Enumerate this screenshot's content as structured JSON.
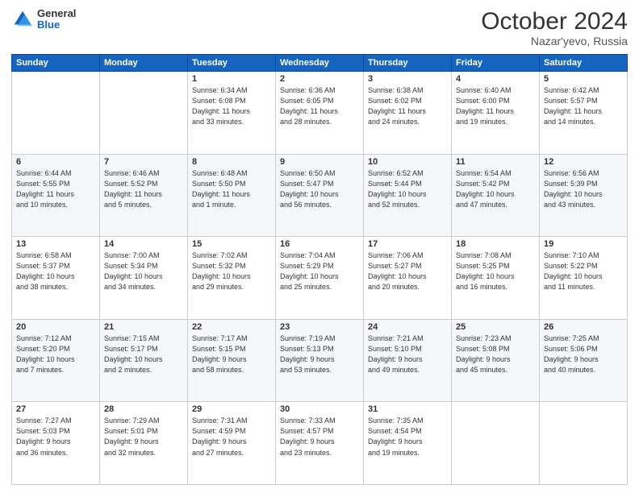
{
  "logo": {
    "general": "General",
    "blue": "Blue"
  },
  "header": {
    "month": "October 2024",
    "location": "Nazar'yevo, Russia"
  },
  "weekdays": [
    "Sunday",
    "Monday",
    "Tuesday",
    "Wednesday",
    "Thursday",
    "Friday",
    "Saturday"
  ],
  "weeks": [
    [
      {
        "day": "",
        "info": ""
      },
      {
        "day": "",
        "info": ""
      },
      {
        "day": "1",
        "info": "Sunrise: 6:34 AM\nSunset: 6:08 PM\nDaylight: 11 hours\nand 33 minutes."
      },
      {
        "day": "2",
        "info": "Sunrise: 6:36 AM\nSunset: 6:05 PM\nDaylight: 11 hours\nand 28 minutes."
      },
      {
        "day": "3",
        "info": "Sunrise: 6:38 AM\nSunset: 6:02 PM\nDaylight: 11 hours\nand 24 minutes."
      },
      {
        "day": "4",
        "info": "Sunrise: 6:40 AM\nSunset: 6:00 PM\nDaylight: 11 hours\nand 19 minutes."
      },
      {
        "day": "5",
        "info": "Sunrise: 6:42 AM\nSunset: 5:57 PM\nDaylight: 11 hours\nand 14 minutes."
      }
    ],
    [
      {
        "day": "6",
        "info": "Sunrise: 6:44 AM\nSunset: 5:55 PM\nDaylight: 11 hours\nand 10 minutes."
      },
      {
        "day": "7",
        "info": "Sunrise: 6:46 AM\nSunset: 5:52 PM\nDaylight: 11 hours\nand 5 minutes."
      },
      {
        "day": "8",
        "info": "Sunrise: 6:48 AM\nSunset: 5:50 PM\nDaylight: 11 hours\nand 1 minute."
      },
      {
        "day": "9",
        "info": "Sunrise: 6:50 AM\nSunset: 5:47 PM\nDaylight: 10 hours\nand 56 minutes."
      },
      {
        "day": "10",
        "info": "Sunrise: 6:52 AM\nSunset: 5:44 PM\nDaylight: 10 hours\nand 52 minutes."
      },
      {
        "day": "11",
        "info": "Sunrise: 6:54 AM\nSunset: 5:42 PM\nDaylight: 10 hours\nand 47 minutes."
      },
      {
        "day": "12",
        "info": "Sunrise: 6:56 AM\nSunset: 5:39 PM\nDaylight: 10 hours\nand 43 minutes."
      }
    ],
    [
      {
        "day": "13",
        "info": "Sunrise: 6:58 AM\nSunset: 5:37 PM\nDaylight: 10 hours\nand 38 minutes."
      },
      {
        "day": "14",
        "info": "Sunrise: 7:00 AM\nSunset: 5:34 PM\nDaylight: 10 hours\nand 34 minutes."
      },
      {
        "day": "15",
        "info": "Sunrise: 7:02 AM\nSunset: 5:32 PM\nDaylight: 10 hours\nand 29 minutes."
      },
      {
        "day": "16",
        "info": "Sunrise: 7:04 AM\nSunset: 5:29 PM\nDaylight: 10 hours\nand 25 minutes."
      },
      {
        "day": "17",
        "info": "Sunrise: 7:06 AM\nSunset: 5:27 PM\nDaylight: 10 hours\nand 20 minutes."
      },
      {
        "day": "18",
        "info": "Sunrise: 7:08 AM\nSunset: 5:25 PM\nDaylight: 10 hours\nand 16 minutes."
      },
      {
        "day": "19",
        "info": "Sunrise: 7:10 AM\nSunset: 5:22 PM\nDaylight: 10 hours\nand 11 minutes."
      }
    ],
    [
      {
        "day": "20",
        "info": "Sunrise: 7:12 AM\nSunset: 5:20 PM\nDaylight: 10 hours\nand 7 minutes."
      },
      {
        "day": "21",
        "info": "Sunrise: 7:15 AM\nSunset: 5:17 PM\nDaylight: 10 hours\nand 2 minutes."
      },
      {
        "day": "22",
        "info": "Sunrise: 7:17 AM\nSunset: 5:15 PM\nDaylight: 9 hours\nand 58 minutes."
      },
      {
        "day": "23",
        "info": "Sunrise: 7:19 AM\nSunset: 5:13 PM\nDaylight: 9 hours\nand 53 minutes."
      },
      {
        "day": "24",
        "info": "Sunrise: 7:21 AM\nSunset: 5:10 PM\nDaylight: 9 hours\nand 49 minutes."
      },
      {
        "day": "25",
        "info": "Sunrise: 7:23 AM\nSunset: 5:08 PM\nDaylight: 9 hours\nand 45 minutes."
      },
      {
        "day": "26",
        "info": "Sunrise: 7:25 AM\nSunset: 5:06 PM\nDaylight: 9 hours\nand 40 minutes."
      }
    ],
    [
      {
        "day": "27",
        "info": "Sunrise: 7:27 AM\nSunset: 5:03 PM\nDaylight: 9 hours\nand 36 minutes."
      },
      {
        "day": "28",
        "info": "Sunrise: 7:29 AM\nSunset: 5:01 PM\nDaylight: 9 hours\nand 32 minutes."
      },
      {
        "day": "29",
        "info": "Sunrise: 7:31 AM\nSunset: 4:59 PM\nDaylight: 9 hours\nand 27 minutes."
      },
      {
        "day": "30",
        "info": "Sunrise: 7:33 AM\nSunset: 4:57 PM\nDaylight: 9 hours\nand 23 minutes."
      },
      {
        "day": "31",
        "info": "Sunrise: 7:35 AM\nSunset: 4:54 PM\nDaylight: 9 hours\nand 19 minutes."
      },
      {
        "day": "",
        "info": ""
      },
      {
        "day": "",
        "info": ""
      }
    ]
  ]
}
